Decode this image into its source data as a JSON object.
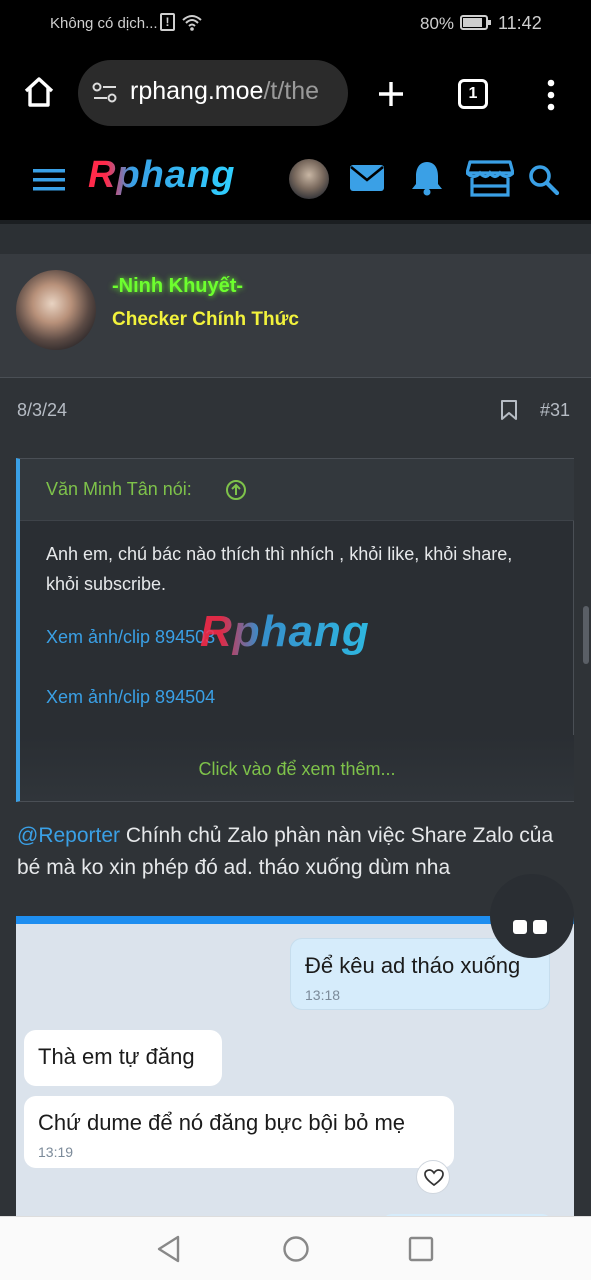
{
  "status": {
    "carrier": "Không có dịch...",
    "battery": "80%",
    "time": "11:42"
  },
  "browser": {
    "url_domain": "rphang.moe",
    "url_path": "/t/the",
    "tab_count": "1"
  },
  "site": {
    "logo": "Rphang"
  },
  "post": {
    "username": "-Ninh Khuyết-",
    "user_title": "Checker Chính Thức",
    "date": "8/3/24",
    "post_number": "#31",
    "quote": {
      "author": "Văn Minh Tân nói:",
      "text": "Anh em, chú bác nào thích thì nhích , khỏi like, khỏi share, khỏi subscribe.",
      "link1": "Xem ảnh/clip 894503",
      "link2": "Xem ảnh/clip 894504",
      "expand": "Click vào để xem thêm...",
      "watermark": "Rphang"
    },
    "mention": "@Reporter",
    "body": " Chính chủ Zalo phàn nàn việc Share Zalo của bé mà ko xin phép đó ad. tháo xuống dùm nha"
  },
  "chat": {
    "messages": [
      {
        "text": "Để kêu ad tháo xuống",
        "time": "13:18",
        "side": "right"
      },
      {
        "text": "Thà em tự đăng",
        "time": "",
        "side": "left"
      },
      {
        "text": "Chứ dume để nó đăng bực bội bỏ mẹ",
        "time": "13:19",
        "side": "left"
      }
    ]
  },
  "colors": {
    "accent_blue": "#3aa0e6",
    "username_green": "#6dff2e",
    "title_yellow": "#f2f23c",
    "quote_green": "#7ec24a"
  }
}
